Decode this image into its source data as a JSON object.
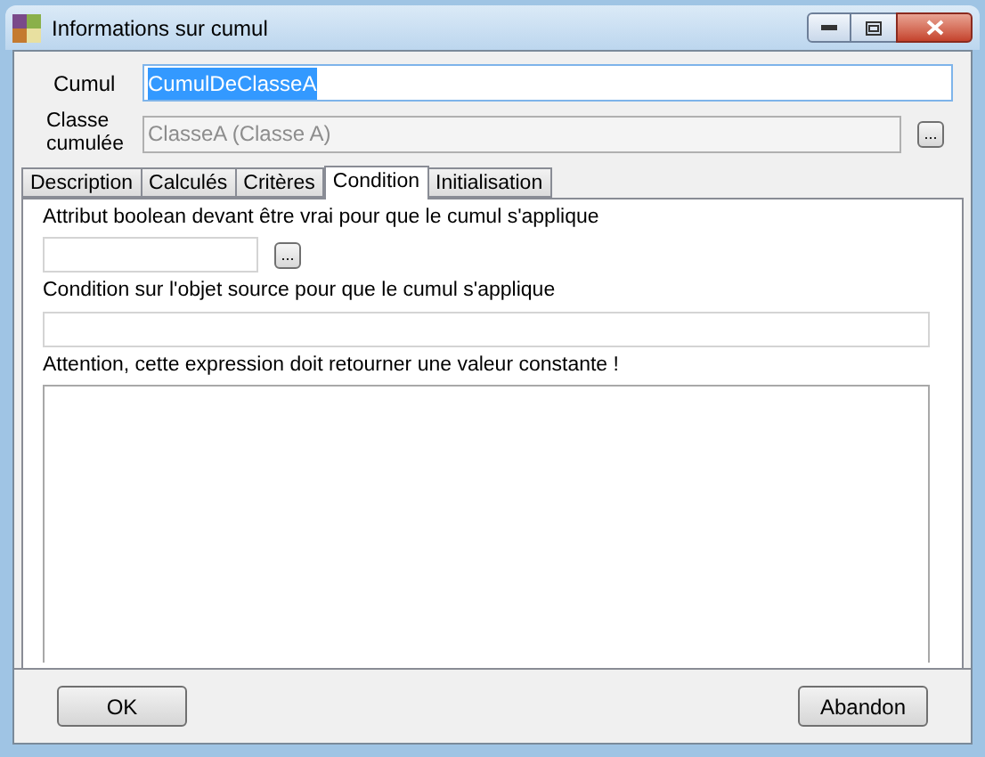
{
  "window": {
    "title": "Informations sur cumul"
  },
  "cumul": {
    "label": "Cumul",
    "value": "CumulDeClasseA",
    "selected": true
  },
  "classe": {
    "label": "Classe cumulée",
    "value": "ClasseA (Classe A)",
    "disabled": true,
    "browse": "..."
  },
  "tabs": [
    {
      "label": "Description",
      "selected": false
    },
    {
      "label": "Calculés",
      "selected": false
    },
    {
      "label": "Critères",
      "selected": false
    },
    {
      "label": "Condition",
      "selected": true
    },
    {
      "label": "Initialisation",
      "selected": false
    }
  ],
  "condition": {
    "attribute_label": "Attribut boolean devant être vrai pour que le cumul s'applique",
    "attribute_browse": "...",
    "source_label": "Condition sur l'objet source pour que le cumul s'applique",
    "warning": "Attention, cette expression doit retourner une valeur constante !"
  },
  "buttons": [
    "OK",
    "Abandon"
  ]
}
